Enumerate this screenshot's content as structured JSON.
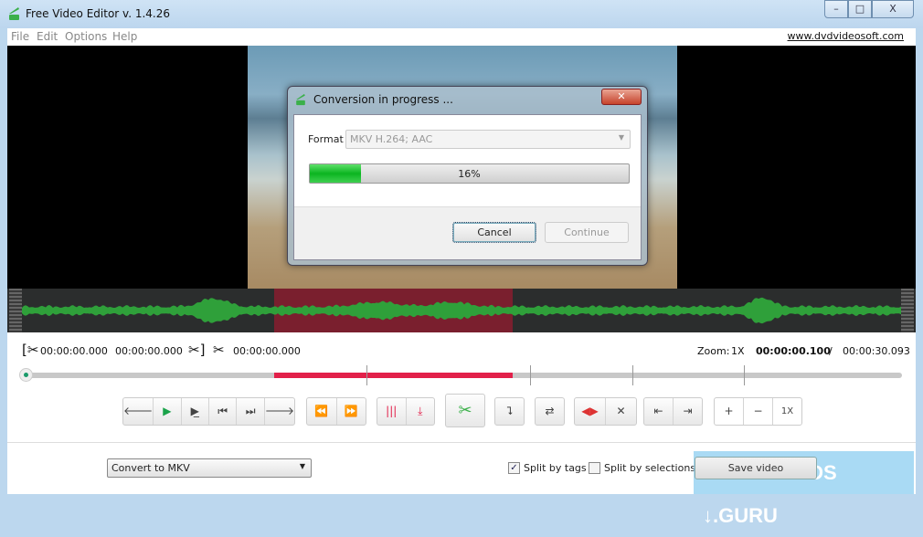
{
  "window": {
    "title": "Free Video Editor v. 1.4.26",
    "minimize": "–",
    "maximize": "□",
    "close": "X"
  },
  "menu": {
    "items": [
      "File",
      "Edit",
      "Options",
      "Help"
    ],
    "site_link": "www.dvdvideosoft.com"
  },
  "dialog": {
    "title": "Conversion in progress ...",
    "close": "✕",
    "format_label": "Format",
    "format_value": "MKV H.264; AAC",
    "progress_percent": 16,
    "progress_text": "16%",
    "cancel": "Cancel",
    "continue": "Continue"
  },
  "times": {
    "start": "00:00:00.000",
    "mid": "00:00:00.000",
    "end": "00:00:00.000",
    "zoom_label": "Zoom:",
    "zoom_value": "1X",
    "current": "00:00:00.100",
    "separator": "/",
    "total": "00:00:30.093"
  },
  "toolbar": {
    "zoom_reset": "1X"
  },
  "bottom": {
    "convert_select": "Convert to MKV",
    "split_tags": "Split by tags",
    "split_tags_checked": true,
    "split_selections": "Split by selections",
    "split_selections_checked": false,
    "save_button": "Save video"
  },
  "watermark": "DOWNLOADS ↓.GURU",
  "colors": {
    "accent_red": "#e2204a",
    "progress_green": "#0bb520",
    "wave_green": "#2fa03a"
  }
}
